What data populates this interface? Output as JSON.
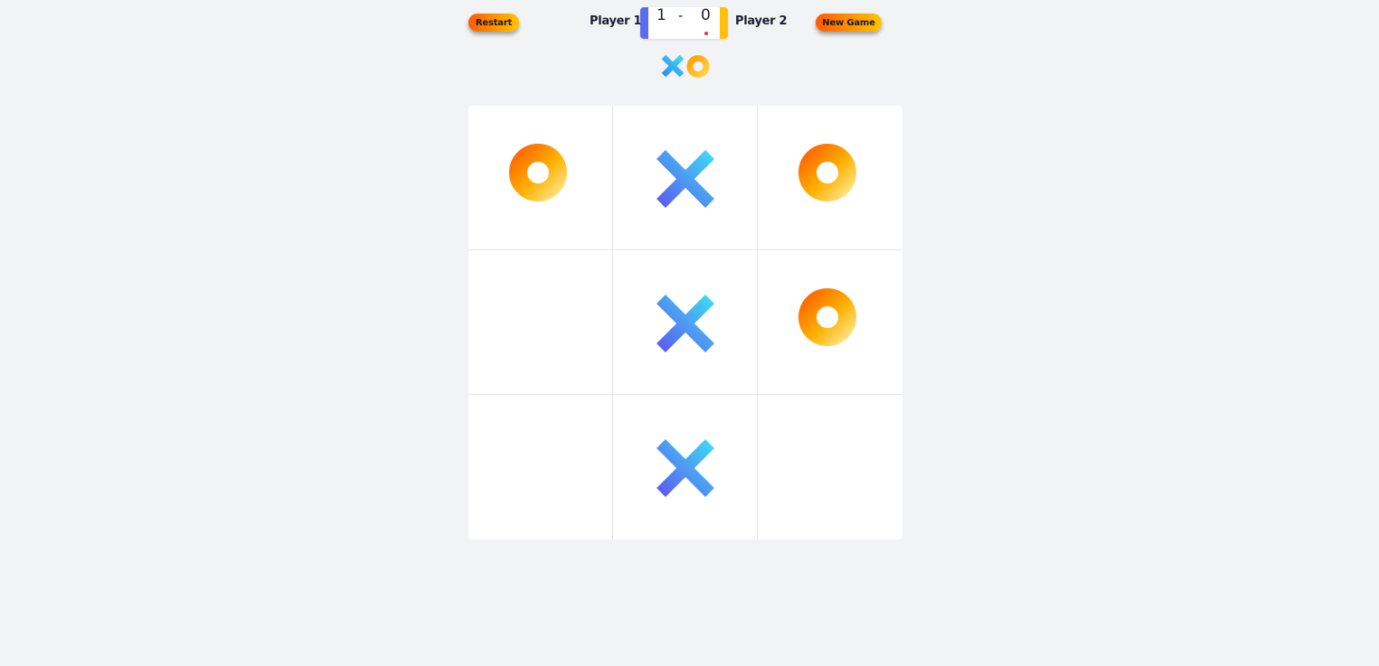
{
  "header": {
    "restart_label": "Restart",
    "new_game_label": "New Game",
    "player1_label": "Player 1",
    "player2_label": "Player 2",
    "score": {
      "player1": "1",
      "separator": "-",
      "player2": "0"
    }
  },
  "logo": {
    "icon": "xo-logo-icon"
  },
  "board": {
    "cells": [
      "O",
      "X",
      "O",
      "",
      "X",
      "O",
      "",
      "X",
      ""
    ]
  },
  "colors": {
    "x_gradient": [
      "#5b5ff0",
      "#3fd6f5"
    ],
    "o_gradient": [
      "#ff6a00",
      "#ffd54a"
    ],
    "player1_accent": "#5b6cf0",
    "player2_accent": "#ffc107",
    "background": "#f2f3f5"
  }
}
